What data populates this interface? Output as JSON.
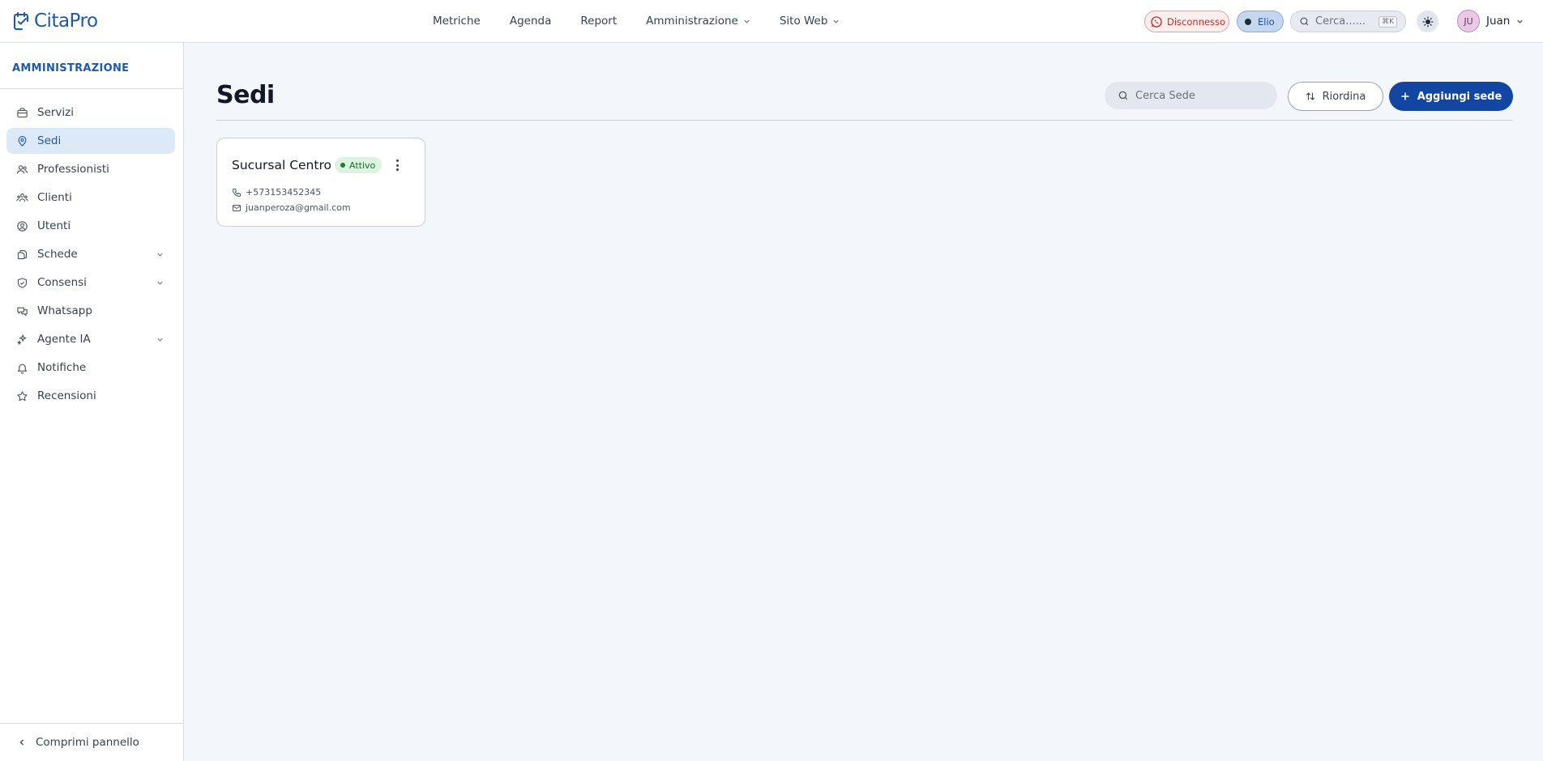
{
  "app": {
    "logo_text": "CitaPro",
    "colors": {
      "brand": "#1e5aa8",
      "primary_button": "#1246a2",
      "active_nav_bg": "#dbe9f9",
      "status_ok": "#1f7a35",
      "disconnected": "#c62828"
    }
  },
  "topnav": {
    "items": [
      {
        "label": "Metriche",
        "has_dropdown": false
      },
      {
        "label": "Agenda",
        "has_dropdown": false
      },
      {
        "label": "Report",
        "has_dropdown": false
      },
      {
        "label": "Amministrazione",
        "has_dropdown": true
      },
      {
        "label": "Sito Web",
        "has_dropdown": true
      }
    ],
    "whatsapp_status": "Disconnesso",
    "agent_pill": "Elio",
    "search_placeholder": "Cerca......",
    "search_shortcut": "⌘K",
    "theme_icon": "sun-icon",
    "user": {
      "initials": "JU",
      "name": "Juan"
    }
  },
  "sidebar": {
    "section_title": "AMMINISTRAZIONE",
    "items": [
      {
        "label": "Servizi",
        "icon": "briefcase-icon",
        "active": false,
        "expandable": false
      },
      {
        "label": "Sedi",
        "icon": "map-pin-icon",
        "active": true,
        "expandable": false
      },
      {
        "label": "Professionisti",
        "icon": "users-icon",
        "active": false,
        "expandable": false
      },
      {
        "label": "Clienti",
        "icon": "clients-icon",
        "active": false,
        "expandable": false
      },
      {
        "label": "Utenti",
        "icon": "user-circle-icon",
        "active": false,
        "expandable": false
      },
      {
        "label": "Schede",
        "icon": "files-icon",
        "active": false,
        "expandable": true
      },
      {
        "label": "Consensi",
        "icon": "shield-check-icon",
        "active": false,
        "expandable": true
      },
      {
        "label": "Whatsapp",
        "icon": "chat-icon",
        "active": false,
        "expandable": false
      },
      {
        "label": "Agente IA",
        "icon": "sparkles-icon",
        "active": false,
        "expandable": true
      },
      {
        "label": "Notifiche",
        "icon": "bell-icon",
        "active": false,
        "expandable": false
      },
      {
        "label": "Recensioni",
        "icon": "star-icon",
        "active": false,
        "expandable": false
      }
    ],
    "collapse_label": "Comprimi pannello"
  },
  "main": {
    "title": "Sedi",
    "search_placeholder": "Cerca Sede",
    "reorder_label": "Riordina",
    "add_label": "Aggiungi sede",
    "locations": [
      {
        "name": "Sucursal Centro",
        "status": "Attivo",
        "phone": "+573153452345",
        "email": "juanperoza@gmail.com"
      }
    ]
  }
}
